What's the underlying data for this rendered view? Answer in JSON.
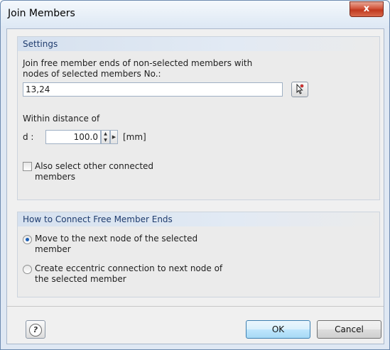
{
  "window": {
    "title": "Join Members",
    "close_label": "x"
  },
  "settings": {
    "header": "Settings",
    "join_label": "Join free member ends of non-selected members with\nnodes of selected members No.:",
    "members_value": "13,24",
    "distance_label": "Within distance of",
    "d_label": "d :",
    "distance_value": "100.0",
    "unit": "[mm]",
    "also_select_label": "Also select other connected\nmembers",
    "also_select_checked": false
  },
  "connect": {
    "header": "How to Connect Free Member Ends",
    "options": [
      {
        "label": "Move to the next node of the selected\nmember",
        "checked": true
      },
      {
        "label": "Create eccentric connection to next node of\nthe selected member",
        "checked": false
      }
    ]
  },
  "footer": {
    "ok_label": "OK",
    "cancel_label": "Cancel"
  },
  "icons": {
    "help": "help-icon",
    "pick": "pick-pointer-icon"
  }
}
